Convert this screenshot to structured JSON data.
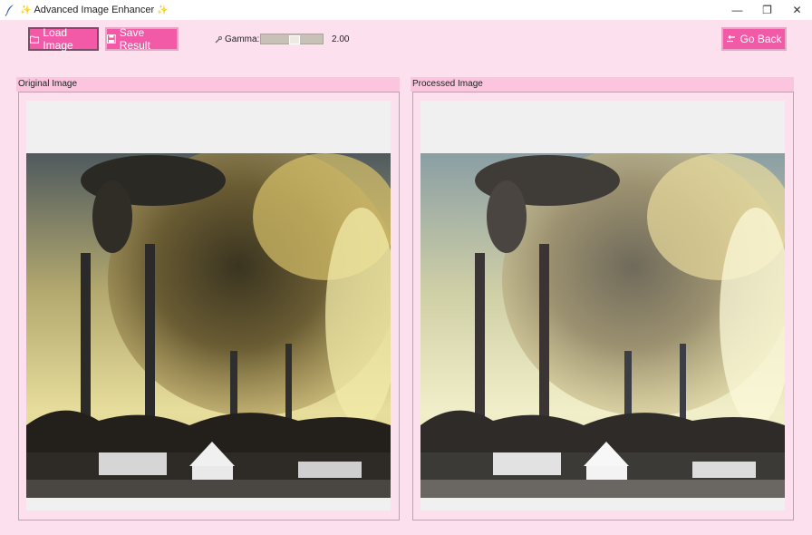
{
  "window": {
    "title": "Advanced Image Enhancer",
    "title_spark": "✨",
    "minimize_glyph": "—",
    "restore_glyph": "❐",
    "close_glyph": "✕"
  },
  "toolbar": {
    "load_label": "Load Image",
    "save_label": "Save Result",
    "back_label": "Go Back",
    "gamma_label": "Gamma:",
    "gamma_value": "2.00",
    "gamma_level": 2.0
  },
  "panels": {
    "original_title": "Original Image",
    "processed_title": "Processed Image"
  },
  "icons": {
    "app": "feather-icon",
    "load": "folder-icon",
    "save": "floppy-disk-icon",
    "gamma": "wrench-icon",
    "back": "back-arrows-icon"
  },
  "colors": {
    "background": "#fde0ee",
    "button": "#f25aa8",
    "panel_header": "#fbc5df"
  }
}
